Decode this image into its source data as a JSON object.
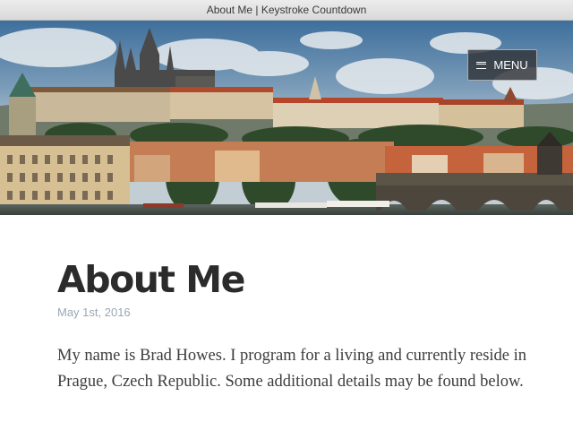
{
  "window": {
    "title": "About Me | Keystroke Countdown"
  },
  "header": {
    "menu_label": "MENU",
    "hero_image": "prague-panorama"
  },
  "article": {
    "title": "About Me",
    "date": "May 1st, 2016",
    "intro": "My name is Brad Howes. I program for a living and currently reside in Prague, Czech Republic. Some additional details may be found below."
  },
  "colors": {
    "title_text": "#2b2b2b",
    "date_text": "#9aa7b3",
    "body_text": "#3d3d3d",
    "menu_bg": "#323438"
  }
}
